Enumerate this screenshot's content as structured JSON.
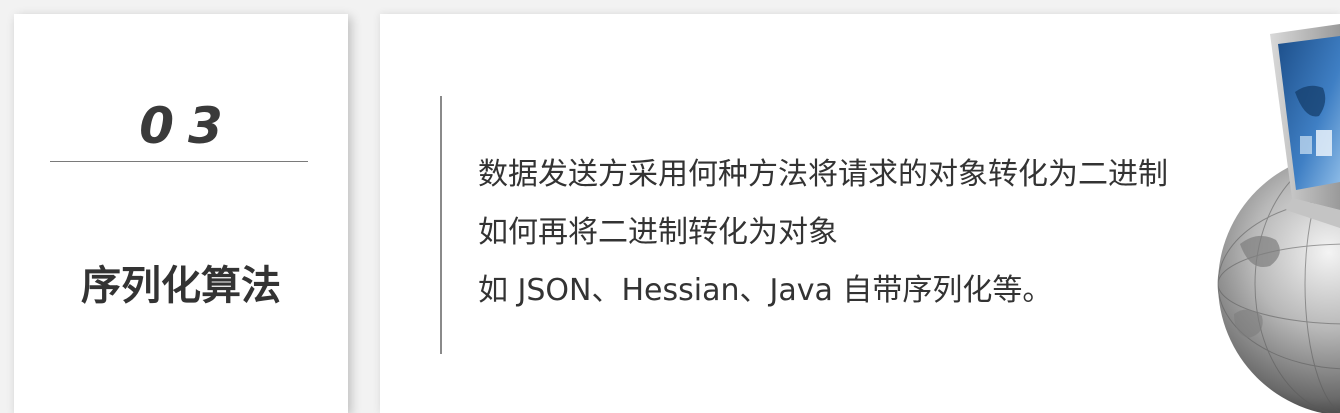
{
  "card": {
    "number": "03",
    "title": "序列化算法"
  },
  "description": {
    "lines": [
      "数据发送方采用何种方法将请求的对象转化为二进制",
      "如何再将二进制转化为对象",
      "如 JSON、Hessian、Java 自带序列化等。"
    ]
  },
  "illustration": {
    "icon": "laptop-on-globe-icon"
  }
}
